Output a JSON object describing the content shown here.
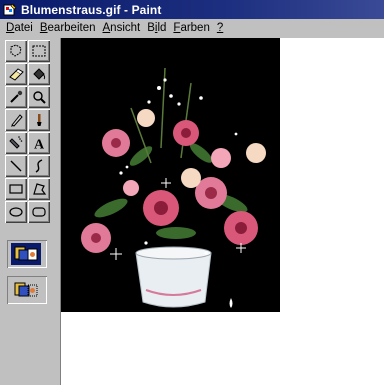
{
  "window": {
    "title": "Blumenstraus.gif - Paint",
    "app_icon": "paint-app-icon"
  },
  "menu": [
    {
      "label": "Datei",
      "accel": "D"
    },
    {
      "label": "Bearbeiten",
      "accel": "B"
    },
    {
      "label": "Ansicht",
      "accel": "A"
    },
    {
      "label": "Bild",
      "accel": "i"
    },
    {
      "label": "Farben",
      "accel": "F"
    },
    {
      "label": "?",
      "accel": "?"
    }
  ],
  "tools": [
    {
      "name": "free-form-select-icon"
    },
    {
      "name": "rect-select-icon"
    },
    {
      "name": "eraser-icon"
    },
    {
      "name": "fill-bucket-icon"
    },
    {
      "name": "color-picker-icon"
    },
    {
      "name": "magnifier-icon"
    },
    {
      "name": "pencil-icon"
    },
    {
      "name": "brush-icon"
    },
    {
      "name": "airbrush-icon"
    },
    {
      "name": "text-icon",
      "glyph": "A"
    },
    {
      "name": "line-icon"
    },
    {
      "name": "curve-icon"
    },
    {
      "name": "rectangle-icon"
    },
    {
      "name": "polygon-icon"
    },
    {
      "name": "ellipse-icon"
    },
    {
      "name": "rounded-rect-icon"
    }
  ],
  "tool_options": [
    {
      "name": "opaque-background-option",
      "selected": true
    },
    {
      "name": "transparent-background-option",
      "selected": false
    }
  ],
  "canvas": {
    "background_color": "#ffffff",
    "image_background": "#000000",
    "image_description_icon": "flower-bouquet-image"
  },
  "colors": {
    "title_bar": "#0a1a6a",
    "face": "#c0c0c0"
  }
}
